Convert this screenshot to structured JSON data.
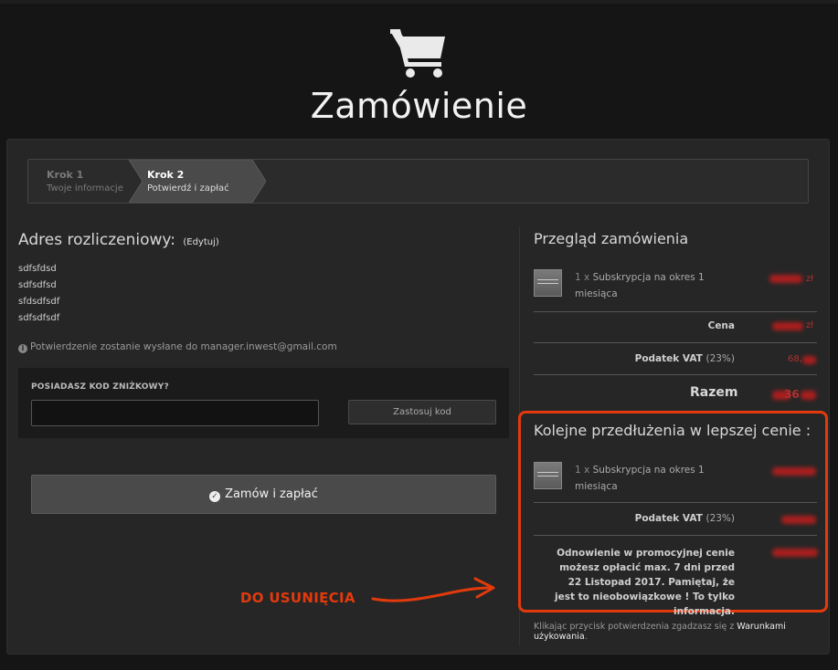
{
  "header": {
    "cart_icon": "shopping-cart-icon",
    "title": "Zamówienie"
  },
  "steps": [
    {
      "title": "Krok 1",
      "subtitle": "Twoje informacje",
      "active": false
    },
    {
      "title": "Krok 2",
      "subtitle": "Potwierdź i zapłać",
      "active": true
    }
  ],
  "billing": {
    "title": "Adres rozliczeniowy:",
    "edit_link": "(Edytuj)",
    "lines": [
      "sdfsfdsd",
      "sdfsdfsd",
      "sfdsdfsdf",
      "sdfsdfsdf"
    ],
    "confirmation_note": "Potwierdzenie zostanie wysłane do manager.inwest@gmail.com"
  },
  "discount": {
    "label": "POSIADASZ KOD ZNIŻKOWY?",
    "input_value": "",
    "apply_button": "Zastosuj kod"
  },
  "order_button": "Zamów i zapłać",
  "annotation": "DO USUNIĘCIA",
  "summary": {
    "title": "Przegląd zamówienia",
    "item": {
      "qty": "1 x",
      "name_line1": "Subskrypcja na okres 1",
      "name_line2": "miesiąca",
      "price_suffix": "zł"
    },
    "price_label": "Cena",
    "price_suffix": "zł",
    "vat_label": "Podatek VAT",
    "vat_pct": "(23%)",
    "vat_value": "68,",
    "total_label": "Razem",
    "total_value": "36"
  },
  "renewal": {
    "title": "Kolejne przedłużenia w lepszej cenie :",
    "item": {
      "qty": "1 x",
      "name_line1": "Subskrypcja na okres 1",
      "name_line2": "miesiąca"
    },
    "vat_label": "Podatek VAT",
    "vat_pct": "(23%)",
    "note": "Odnowienie w promocyjnej cenie możesz opłacić max. 7 dni przed 22 Listopad 2017. Pamiętaj, że jest to nieobowiązkowe ! To tylko informacja."
  },
  "terms": {
    "text": "Klikając przycisk potwierdzenia zgadzasz się z",
    "link": "Warunkami użykowania",
    "end": "."
  },
  "colors": {
    "annotation": "#e23a0c",
    "background": "#151515",
    "panel": "#262626"
  }
}
